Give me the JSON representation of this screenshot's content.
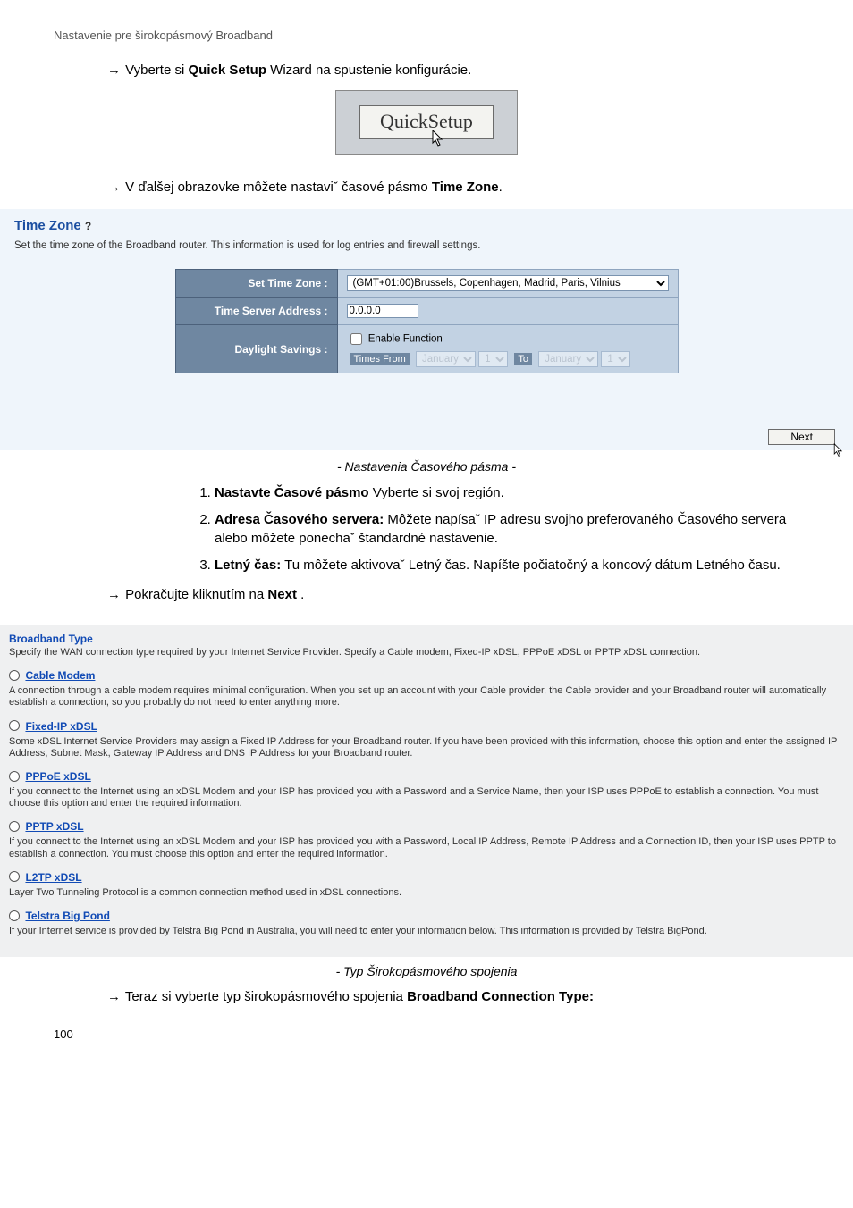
{
  "header": "Nastavenie pre širokopásmový Broadband",
  "lines": {
    "l1_pre": "Vyberte si ",
    "l1_bold": "Quick Setup",
    "l1_post": " Wizard na spustenie konfigurácie.",
    "l2_pre": "V ďalšej obrazovke môžete nastaviˇ časové pásmo ",
    "l2_bold": "Time Zone",
    "l2_post": ".",
    "l3_pre": "Pokračujte kliknutím na ",
    "l3_bold": "Next",
    "l3_post": " .",
    "l4_pre": "Teraz si vyberte typ širokopásmového spojenia ",
    "l4_bold": "Broadband Connection Type:"
  },
  "quicksetup": {
    "label": "QuickSetup"
  },
  "timezone": {
    "title": "Time Zone ",
    "subtitle": "Set the time zone of the Broadband router. This information is used for log entries and firewall settings.",
    "row1_label": "Set Time Zone :",
    "row1_value": "(GMT+01:00)Brussels, Copenhagen, Madrid, Paris, Vilnius",
    "row2_label": "Time Server Address :",
    "row2_value": "0.0.0.0",
    "row3_label": "Daylight Savings :",
    "enable_label": "Enable Function",
    "times_from": "Times From",
    "month": "January",
    "day": "1",
    "to_label": "To",
    "next_label": "Next"
  },
  "caption_tz": "- Nastavenia Časového pásma -",
  "numbered": [
    {
      "lead": "Nastavte Časové pásmo",
      "rest": " Vyberte si svoj región."
    },
    {
      "lead": "Adresa Časového servera:",
      "rest": "  Môžete napísaˇ IP adresu svojho preferovaného Časového servera alebo môžete ponechaˇ štandardné nastavenie."
    },
    {
      "lead": "Letný čas:",
      "rest": " Tu môžete aktivovaˇ Letný čas. Napíšte počiatočný a koncový dátum Letného času."
    }
  ],
  "broadband": {
    "heading": "Broadband Type",
    "heading_desc": "Specify the WAN connection type required by your Internet Service Provider. Specify a Cable modem, Fixed-IP xDSL, PPPoE xDSL or PPTP xDSL connection.",
    "options": [
      {
        "title": " Cable Modem",
        "desc": "A connection through a cable modem requires minimal configuration. When you set up an account with your Cable provider, the Cable provider and your Broadband router will automatically establish a connection, so you probably do not need to enter anything more."
      },
      {
        "title": " Fixed-IP xDSL",
        "desc": "Some xDSL Internet Service Providers may assign a Fixed IP Address for your Broadband router. If you have been provided with this information, choose this option and enter the assigned IP Address, Subnet Mask, Gateway IP Address and DNS IP Address for your Broadband router."
      },
      {
        "title": " PPPoE xDSL",
        "desc": "If you connect to the Internet using an xDSL Modem and your ISP has provided you with a Password and a Service Name, then your ISP uses PPPoE to establish a connection. You must choose this option and enter the required information."
      },
      {
        "title": " PPTP xDSL",
        "desc": "If you connect to the Internet using an xDSL Modem and your ISP has provided you with a Password, Local IP Address, Remote IP Address and a Connection ID, then your ISP uses PPTP to establish a connection. You must choose this option and enter the required information."
      },
      {
        "title": " L2TP xDSL",
        "desc": "Layer Two Tunneling Protocol is a common connection method used in xDSL connections."
      },
      {
        "title": " Telstra Big Pond",
        "desc": "If your Internet service is provided by Telstra Big Pond in Australia, you will need to enter your information below. This information is provided by Telstra BigPond."
      }
    ]
  },
  "caption_bb": "- Typ  Širokopásmového spojenia",
  "pagenum": "100"
}
